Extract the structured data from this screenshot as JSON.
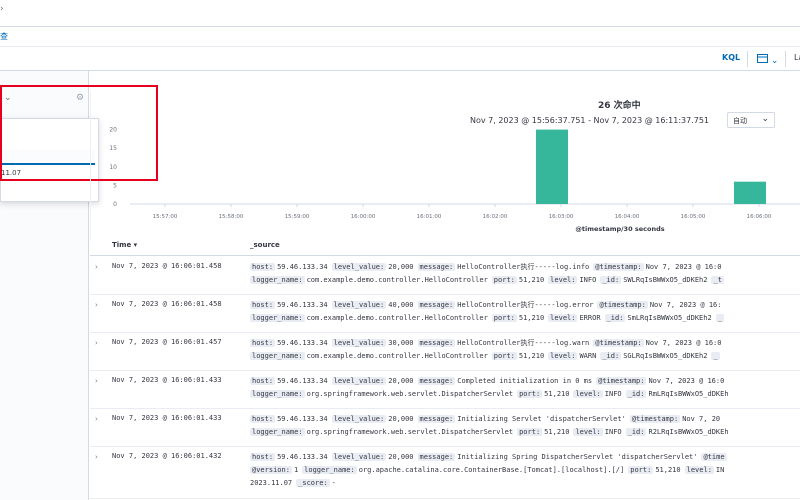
{
  "toolbar": {
    "kql": "KQL",
    "calendar_icon": "calendar-icon",
    "last_label": "La"
  },
  "subbar": {
    "link": "查"
  },
  "summary": {
    "hits": "26 次命中",
    "range": "Nov 7, 2023 @ 15:56:37.751 - Nov 7, 2023 @ 16:11:37.751",
    "interval": "自动"
  },
  "popover": {
    "value": "11.07"
  },
  "chart_data": {
    "type": "bar",
    "x": [
      "15:57:00",
      "15:58:00",
      "15:59:00",
      "16:00:00",
      "16:01:00",
      "16:02:00",
      "16:03:00",
      "16:04:00",
      "16:05:00",
      "16:06:00"
    ],
    "bars": [
      {
        "x": "16:03:00",
        "value": 20
      },
      {
        "x": "16:06:00",
        "value": 6
      }
    ],
    "xlabel": "@timestamp/30 seconds",
    "ylabel": "",
    "yticks": [
      0,
      5,
      10,
      15,
      20
    ],
    "ylim": [
      0,
      25
    ],
    "bar_color": "#36b69b"
  },
  "table": {
    "headers": {
      "time": "Time",
      "source": "_source"
    },
    "rows": [
      {
        "time": "Nov 7, 2023 @ 16:06:01.458",
        "l1": [
          [
            "host:",
            "59.46.133.34"
          ],
          [
            "level_value:",
            "20,000"
          ],
          [
            "message:",
            "HelloController执行-----log.info"
          ],
          [
            "@timestamp:",
            "Nov 7, 2023 @ 16:0"
          ]
        ],
        "l2": [
          [
            "logger_name:",
            "com.example.demo.controller.HelloController"
          ],
          [
            "port:",
            "51,210"
          ],
          [
            "level:",
            "INFO"
          ],
          [
            "_id:",
            "SWLRqIsBWWxO5_dDKEh2"
          ],
          [
            "_t",
            ""
          ]
        ]
      },
      {
        "time": "Nov 7, 2023 @ 16:06:01.458",
        "l1": [
          [
            "host:",
            "59.46.133.34"
          ],
          [
            "level_value:",
            "40,000"
          ],
          [
            "message:",
            "HelloController执行-----log.error"
          ],
          [
            "@timestamp:",
            "Nov 7, 2023 @ 16:"
          ]
        ],
        "l2": [
          [
            "logger_name:",
            "com.example.demo.controller.HelloController"
          ],
          [
            "port:",
            "51,210"
          ],
          [
            "level:",
            "ERROR"
          ],
          [
            "_id:",
            "SmLRqIsBWWxO5_dDKEh2"
          ],
          [
            "_",
            ""
          ]
        ]
      },
      {
        "time": "Nov 7, 2023 @ 16:06:01.457",
        "l1": [
          [
            "host:",
            "59.46.133.34"
          ],
          [
            "level_value:",
            "30,000"
          ],
          [
            "message:",
            "HelloController执行-----log.warn"
          ],
          [
            "@timestamp:",
            "Nov 7, 2023 @ 16:0"
          ]
        ],
        "l2": [
          [
            "logger_name:",
            "com.example.demo.controller.HelloController"
          ],
          [
            "port:",
            "51,210"
          ],
          [
            "level:",
            "WARN"
          ],
          [
            "_id:",
            "SGLRqIsBWWxO5_dDKEh2"
          ],
          [
            "_",
            ""
          ]
        ]
      },
      {
        "time": "Nov 7, 2023 @ 16:06:01.433",
        "l1": [
          [
            "host:",
            "59.46.133.34"
          ],
          [
            "level_value:",
            "20,000"
          ],
          [
            "message:",
            "Completed initialization in 0 ms"
          ],
          [
            "@timestamp:",
            "Nov 7, 2023 @ 16:0"
          ]
        ],
        "l2": [
          [
            "logger_name:",
            "org.springframework.web.servlet.DispatcherServlet"
          ],
          [
            "port:",
            "51,210"
          ],
          [
            "level:",
            "INFO"
          ],
          [
            "_id:",
            "RmLRqIsBWWxO5_dDKEh"
          ]
        ]
      },
      {
        "time": "Nov 7, 2023 @ 16:06:01.433",
        "l1": [
          [
            "host:",
            "59.46.133.34"
          ],
          [
            "level_value:",
            "20,000"
          ],
          [
            "message:",
            "Initializing Servlet 'dispatcherServlet'"
          ],
          [
            "@timestamp:",
            "Nov 7, 20"
          ]
        ],
        "l2": [
          [
            "logger_name:",
            "org.springframework.web.servlet.DispatcherServlet"
          ],
          [
            "port:",
            "51,210"
          ],
          [
            "level:",
            "INFO"
          ],
          [
            "_id:",
            "R2LRqIsBWWxO5_dDKEh"
          ]
        ]
      },
      {
        "time": "Nov 7, 2023 @ 16:06:01.432",
        "l1": [
          [
            "host:",
            "59.46.133.34"
          ],
          [
            "level_value:",
            "20,000"
          ],
          [
            "message:",
            "Initializing Spring DispatcherServlet 'dispatcherServlet'"
          ],
          [
            "@time",
            ""
          ]
        ],
        "l2": [
          [
            "@version:",
            "1"
          ],
          [
            "logger_name:",
            "org.apache.catalina.core.ContainerBase.[Tomcat].[localhost].[/]"
          ],
          [
            "port:",
            "51,210"
          ],
          [
            "level:",
            "IN"
          ]
        ],
        "l3": [
          [
            "",
            "2023.11.07"
          ],
          [
            "_score:",
            "-"
          ]
        ]
      }
    ]
  }
}
